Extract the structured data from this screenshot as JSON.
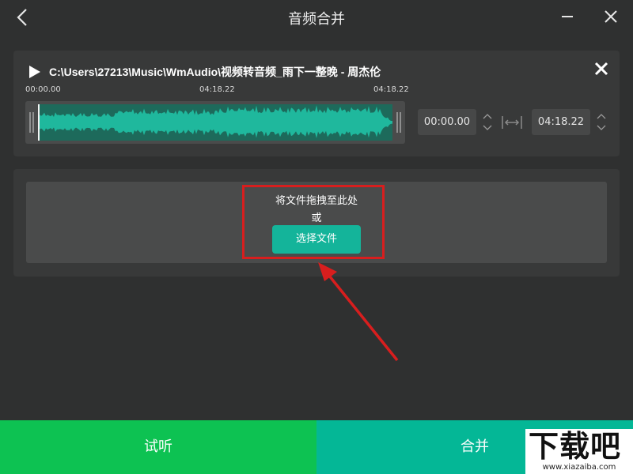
{
  "window": {
    "title": "音频合并"
  },
  "track": {
    "path": "C:\\Users\\27213\\Music\\WmAudio\\视频转音频_雨下一整晚 - 周杰伦",
    "time_start": "00:00.00",
    "time_mid": "04:18.22",
    "time_end": "04:18.22",
    "start_value": "00:00.00",
    "end_value": "04:18.22"
  },
  "dropzone": {
    "hint": "将文件拖拽至此处",
    "or": "或",
    "choose_label": "选择文件"
  },
  "footer": {
    "preview_label": "试听",
    "merge_label": "合并"
  },
  "watermark": {
    "brand": "下载吧",
    "url": "www.xiazaiba.com"
  },
  "colors": {
    "background": "#2f3030",
    "panel": "#383939",
    "accent": "#14b49a",
    "waveform": "#1fb89d",
    "preview_button": "#0dc252",
    "merge_button": "#04b796",
    "annotation": "#d81e1e"
  },
  "icons": [
    "back-arrow-icon",
    "minimize-icon",
    "close-icon",
    "play-icon",
    "remove-icon",
    "spinner-icon",
    "range-icon"
  ]
}
